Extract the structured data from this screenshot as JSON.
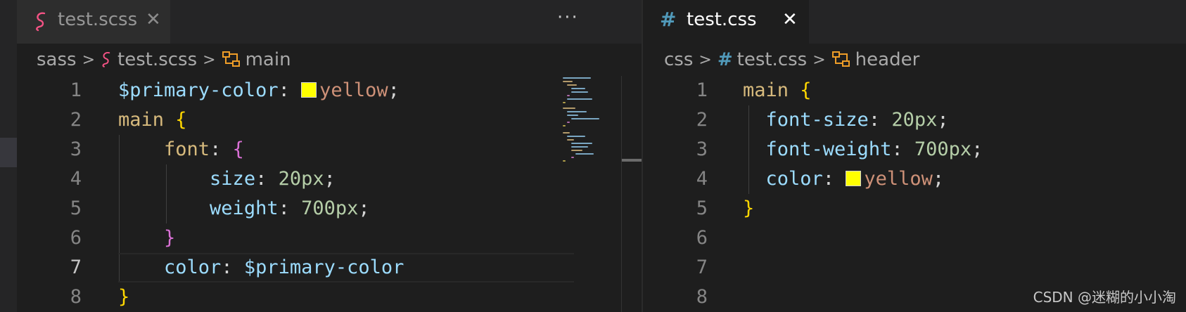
{
  "left_editor": {
    "tab": {
      "title": "test.scss",
      "icon": "sass-icon",
      "active": false
    },
    "more_actions": "···",
    "breadcrumb": {
      "folder": "sass",
      "file": "test.scss",
      "symbol": "main"
    },
    "line_numbers": [
      "1",
      "2",
      "3",
      "4",
      "5",
      "6",
      "7",
      "8"
    ],
    "current_line": "7",
    "code": [
      {
        "var": "$primary-color",
        "colon": ":",
        "swatch": "#ffff00",
        "value": "yellow",
        "semi": ";"
      },
      {
        "sel": "main",
        "brace": "{"
      },
      {
        "prop": "font",
        "colon": ":",
        "brace": "{"
      },
      {
        "prop": "size",
        "colon": ":",
        "num": "20px",
        "semi": ";"
      },
      {
        "prop": "weight",
        "colon": ":",
        "num": "700px",
        "semi": ";"
      },
      {
        "brace": "}"
      },
      {
        "prop": "color",
        "colon": ":",
        "var": "$primary-color"
      },
      {
        "brace": "}"
      }
    ]
  },
  "right_editor": {
    "tab": {
      "title": "test.css",
      "icon": "hash-icon",
      "active": true
    },
    "breadcrumb": {
      "folder": "css",
      "file": "test.css",
      "symbol": "header"
    },
    "line_numbers": [
      "1",
      "2",
      "3",
      "4",
      "5",
      "6",
      "7",
      "8"
    ],
    "code": [
      {
        "sel": "main",
        "brace": "{"
      },
      {
        "prop": "font-size",
        "colon": ":",
        "num": "20px",
        "semi": ";"
      },
      {
        "prop": "font-weight",
        "colon": ":",
        "num": "700px",
        "semi": ";"
      },
      {
        "prop": "color",
        "colon": ":",
        "swatch": "#ffff00",
        "value": "yellow",
        "semi": ";"
      },
      {
        "brace": "}"
      }
    ]
  },
  "watermark": "CSDN @迷糊的小小淘",
  "colors": {
    "editor_bg": "#1e1e1e",
    "tabbar_bg": "#252526",
    "variable": "#9cdcfe",
    "selector": "#d7ba7d",
    "number": "#b5cea8",
    "string": "#ce9178",
    "bracket_level1": "#ffd700",
    "bracket_level2": "#da70d6",
    "sass_icon": "#f55385",
    "css_icon": "#519aba",
    "symbol_icon": "#ee9d28"
  }
}
